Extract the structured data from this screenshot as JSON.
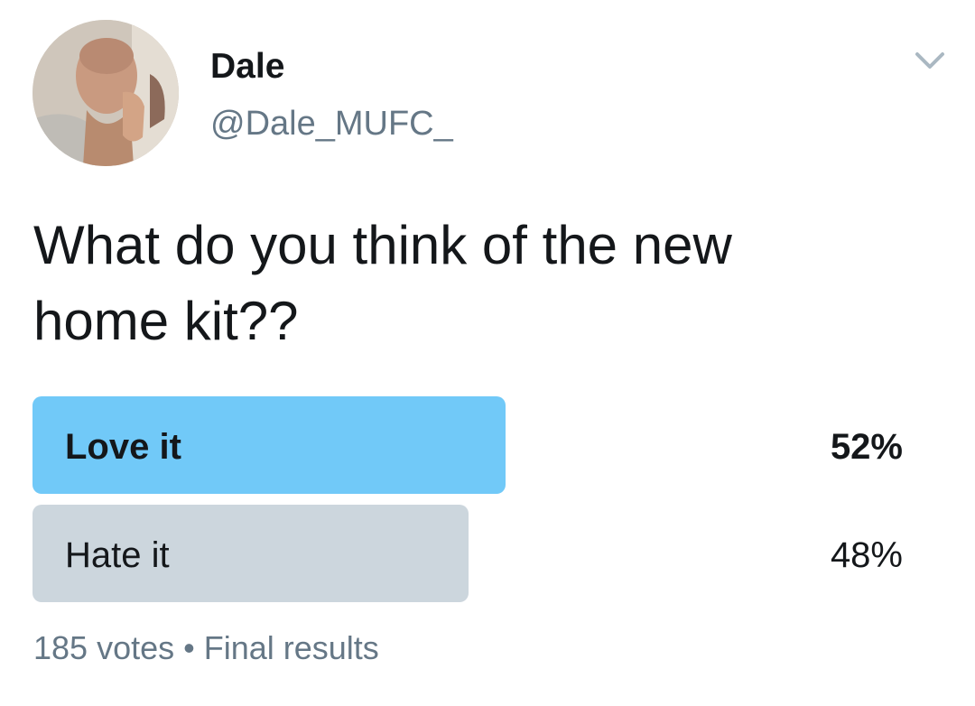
{
  "tweet": {
    "author": {
      "display_name": "Dale",
      "handle": "@Dale_MUFC_"
    },
    "menu_icon": "chevron-down-icon",
    "text_line1": "What do you think of the new",
    "text_line2": "home kit??"
  },
  "poll": {
    "options": [
      {
        "label": "Love it",
        "percent_text": "52%",
        "percent": 52,
        "winner": true,
        "bar_color": "#71c9f8"
      },
      {
        "label": "Hate it",
        "percent_text": "48%",
        "percent": 48,
        "winner": false,
        "bar_color": "#ccd6dd"
      }
    ],
    "votes": "185 votes",
    "separator": "•",
    "status": "Final results"
  },
  "colors": {
    "text": "#14171a",
    "secondary_text": "#657786",
    "winner_bar": "#71c9f8",
    "other_bar": "#ccd6dd"
  }
}
